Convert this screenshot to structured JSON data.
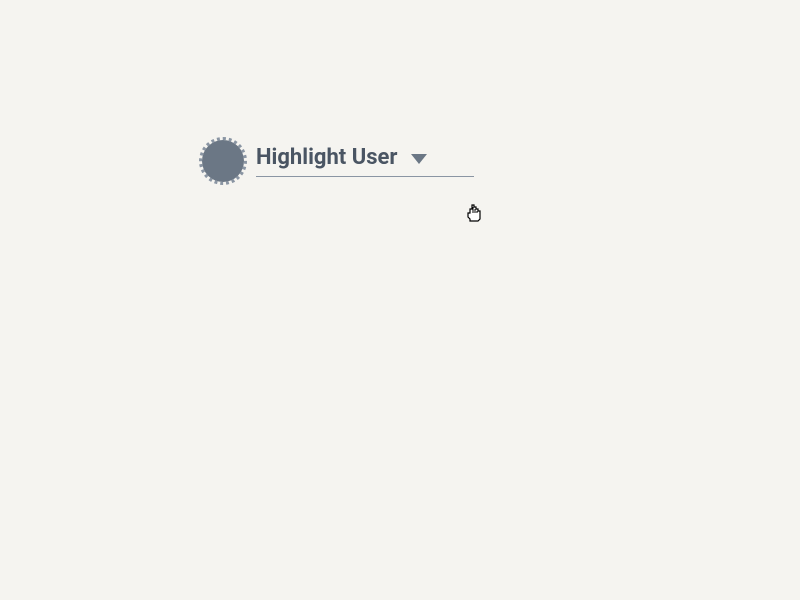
{
  "dropdown": {
    "label": "Highlight User"
  }
}
